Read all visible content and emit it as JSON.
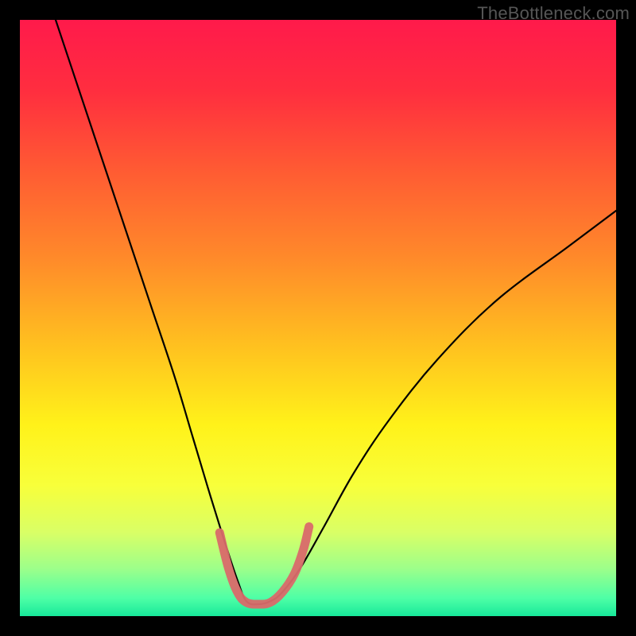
{
  "watermark": "TheBottleneck.com",
  "chart_data": {
    "type": "line",
    "title": "",
    "xlabel": "",
    "ylabel": "",
    "xlim": [
      0,
      100
    ],
    "ylim": [
      0,
      100
    ],
    "background_gradient_stops": [
      {
        "offset": 0.0,
        "color": "#ff1a4b"
      },
      {
        "offset": 0.12,
        "color": "#ff2e3f"
      },
      {
        "offset": 0.25,
        "color": "#ff5a33"
      },
      {
        "offset": 0.4,
        "color": "#ff8a2a"
      },
      {
        "offset": 0.55,
        "color": "#ffc21f"
      },
      {
        "offset": 0.68,
        "color": "#fff21a"
      },
      {
        "offset": 0.78,
        "color": "#f8ff3a"
      },
      {
        "offset": 0.86,
        "color": "#d9ff66"
      },
      {
        "offset": 0.92,
        "color": "#9dff8a"
      },
      {
        "offset": 0.97,
        "color": "#4effa6"
      },
      {
        "offset": 1.0,
        "color": "#17e89a"
      }
    ],
    "series": [
      {
        "name": "bottleneck-curve",
        "color": "#000000",
        "width": 2.2,
        "x": [
          6,
          10,
          14,
          18,
          22,
          26,
          29,
          32,
          34.5,
          36.5,
          38,
          40,
          42,
          44,
          47,
          51,
          56,
          62,
          70,
          80,
          92,
          100
        ],
        "y": [
          100,
          88,
          76,
          64,
          52,
          40,
          30,
          20,
          12,
          6,
          2.5,
          2,
          2.5,
          4,
          8,
          15,
          24,
          33,
          43,
          53,
          62,
          68
        ]
      },
      {
        "name": "optimal-marker",
        "color": "#d96a6a",
        "width": 11,
        "linecap": "round",
        "x": [
          33.5,
          35,
          36.5,
          38,
          40,
          42,
          44,
          46,
          47.5,
          48.5
        ],
        "y": [
          14,
          8,
          4,
          2.3,
          2,
          2.3,
          4,
          7,
          11,
          15
        ]
      }
    ]
  }
}
